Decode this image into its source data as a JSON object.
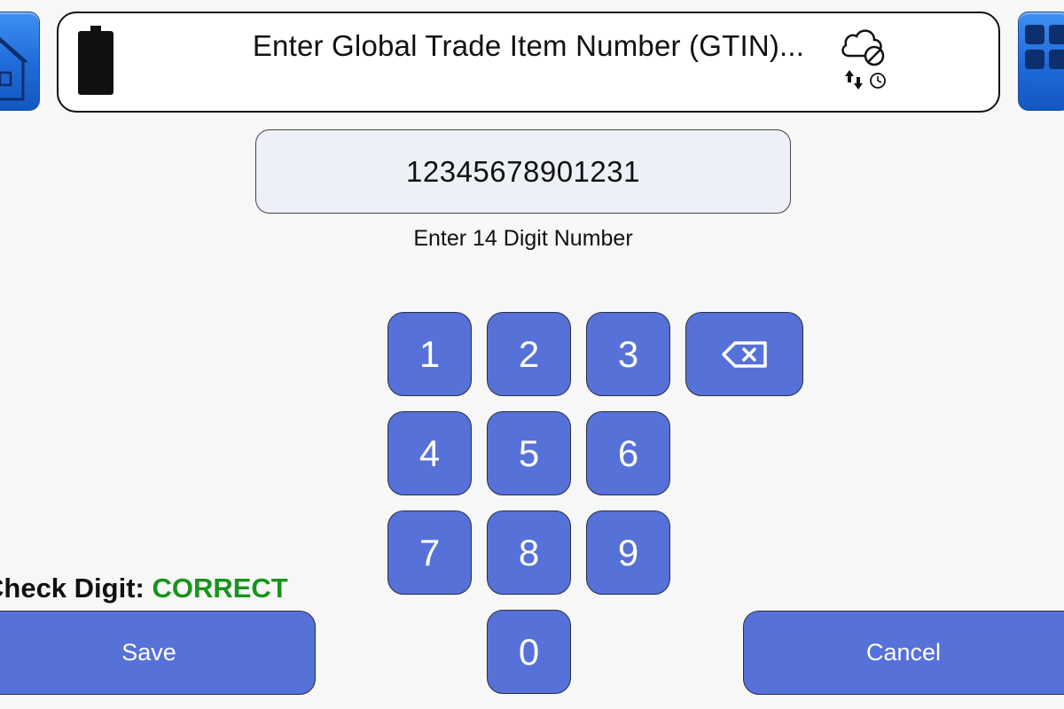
{
  "header": {
    "title": "Enter Global Trade Item Number (GTIN)..."
  },
  "icons": {
    "home": "home-icon",
    "battery": "battery-icon",
    "cloud": "cloud-offline-icon",
    "sync": "sync-arrows-icon",
    "clock": "clock-icon",
    "grid": "grid-menu-icon",
    "backspace": "backspace-icon"
  },
  "display": {
    "value": "12345678901231",
    "hint": "Enter 14 Digit Number"
  },
  "keypad": {
    "k1": "1",
    "k2": "2",
    "k3": "3",
    "k4": "4",
    "k5": "5",
    "k6": "6",
    "k7": "7",
    "k8": "8",
    "k9": "9",
    "k0": "0"
  },
  "check_digit": {
    "label": "Check Digit: ",
    "status": "CORRECT"
  },
  "actions": {
    "save": "Save",
    "cancel": "Cancel"
  },
  "colors": {
    "key_blue": "#5671d8",
    "correct_green": "#19931e",
    "home_blue": "#1e6ad8"
  }
}
